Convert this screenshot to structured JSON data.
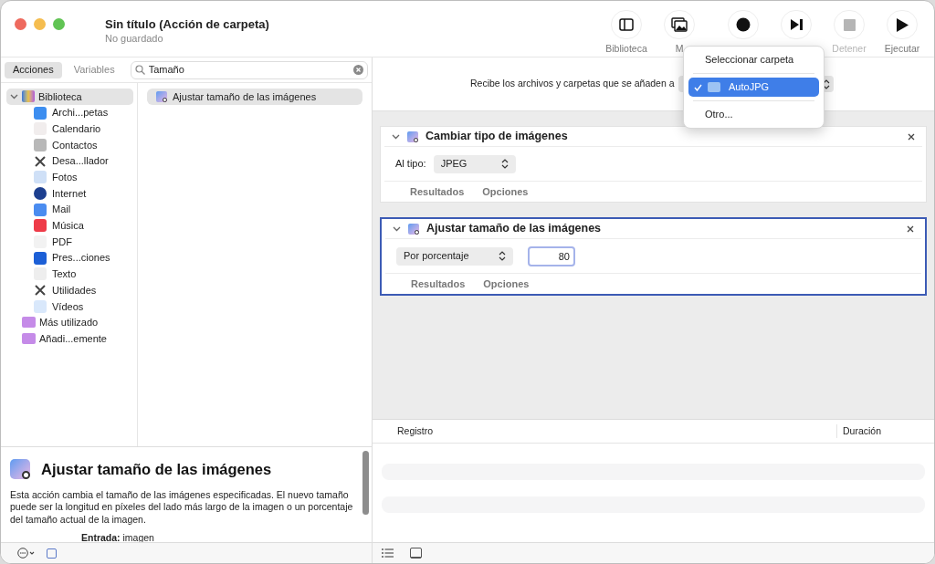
{
  "window": {
    "title": "Sin título (Acción de carpeta)",
    "subtitle": "No guardado"
  },
  "toolbar": [
    {
      "label": "Biblioteca",
      "disabled": false
    },
    {
      "label": "M",
      "disabled": false
    },
    {
      "disabled": false
    },
    {
      "disabled": false
    },
    {
      "label": "Detener",
      "disabled": true
    },
    {
      "label": "Ejecutar",
      "disabled": false
    }
  ],
  "library_tabs": [
    {
      "label": "Acciones",
      "selected": true
    },
    {
      "label": "Variables",
      "selected": false
    }
  ],
  "search": {
    "value": "Tamaño"
  },
  "library": [
    {
      "label": "Biblioteca",
      "selected": true,
      "expanded": true,
      "children": [
        {
          "label": "Archi...petas",
          "selected": false
        },
        {
          "label": "Calendario",
          "selected": false
        },
        {
          "label": "Contactos",
          "selected": false
        },
        {
          "label": "Desa...llador",
          "selected": false
        },
        {
          "label": "Fotos",
          "selected": false
        },
        {
          "label": "Internet",
          "selected": false
        },
        {
          "label": "Mail",
          "selected": false
        },
        {
          "label": "Música",
          "selected": false
        },
        {
          "label": "PDF",
          "selected": false
        },
        {
          "label": "Pres...ciones",
          "selected": false
        },
        {
          "label": "Texto",
          "selected": false
        },
        {
          "label": "Utilidades",
          "selected": false
        },
        {
          "label": "Vídeos",
          "selected": false
        }
      ]
    },
    {
      "label": "Más utilizado",
      "selected": false
    },
    {
      "label": "Añadi...emente",
      "selected": false
    }
  ],
  "actions": [
    {
      "label": "Ajustar tamaño de las imágenes",
      "selected": true
    }
  ],
  "description": {
    "title": "Ajustar tamaño de las imágenes",
    "text": "Esta acción cambia el tamaño de las imágenes especificadas. El nuevo tamaño puede ser la longitud en píxeles del lado más largo de la imagen o un porcentaje del tamaño actual de la imagen.",
    "input": "**Entrada:** imagen"
  },
  "workflow": {
    "header": "Recibe los archivos y carpetas que se añaden a",
    "cards": [
      {
        "kind": "type",
        "title": "Cambiar tipo de imágenes",
        "expanded": true,
        "selected": false,
        "field_label": "Al tipo:",
        "select": "JPEG",
        "tabs": [
          "Resultados",
          "Opciones"
        ]
      },
      {
        "kind": "scale",
        "title": "Ajustar tamaño de las imágenes",
        "expanded": true,
        "selected": true,
        "select": "Por porcentaje",
        "value": "80",
        "tabs": [
          "Resultados",
          "Opciones"
        ]
      }
    ]
  },
  "folder_menu": [
    {
      "label": "Seleccionar carpeta",
      "kind": "title",
      "selected": false
    },
    {
      "label": "AutoJPG",
      "kind": "folder",
      "selected": true
    },
    {
      "label": "Otro...",
      "kind": "item",
      "selected": false
    }
  ],
  "log": {
    "columns": [
      "Registro",
      "Duración"
    ]
  }
}
